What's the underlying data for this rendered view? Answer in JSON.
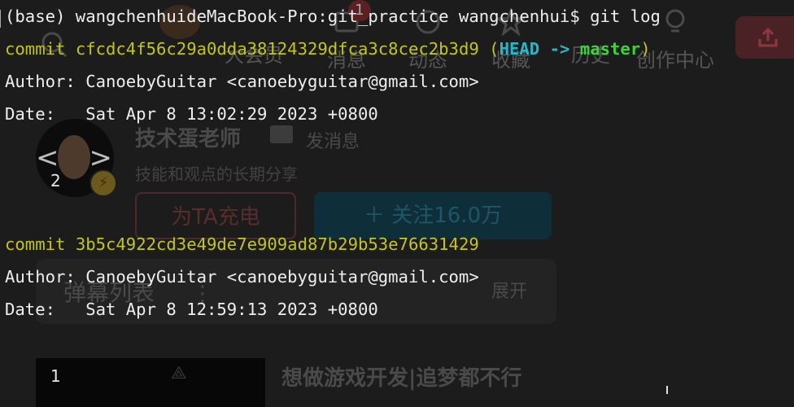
{
  "terminal": {
    "prompt_line": "(base) wangchenhuideMacBook-Pro:git_practice wangchenhui$ git log",
    "commits": [
      {
        "commit_label": "commit",
        "hash": "cfcdc4f56c29a0dda38124329dfca3c8cec2b3d9",
        "ref_open": "(",
        "ref_head": "HEAD",
        "ref_arrow": "->",
        "ref_branch": "master",
        "ref_close": ")",
        "author_line": "Author: CanoebyGuitar <canoebyguitar@gmail.com>",
        "date_line": "Date:   Sat Apr 8 13:02:29 2023 +0800"
      },
      {
        "commit_label": "commit",
        "hash": "3b5c4922cd3e49de7e909ad87b29b53e76631429",
        "author_line": "Author: CanoebyGuitar <canoebyguitar@gmail.com>",
        "date_line": "Date:   Sat Apr 8 12:59:13 2023 +0800"
      }
    ]
  },
  "background_ui": {
    "nav": [
      "大会员",
      "消息",
      "动态",
      "收藏",
      "历史",
      "创作中心"
    ],
    "notify_count": "1",
    "up_name": "技术蛋老师",
    "send_message": "发消息",
    "up_desc": "技能和观点的长期分享",
    "charge_button": "为TA充电",
    "follow_button": "关注16.0万",
    "follow_plus": "＋",
    "danmu_title": "弹幕列表",
    "danmu_dots": "⋮",
    "danmu_expand": "展开",
    "video_title": "想做游戏开发|追梦都不行",
    "overlay_numbers": [
      "2",
      "1"
    ]
  },
  "colors": {
    "terminal_bg": "#1c1c1c",
    "text": "#eeeeee",
    "commit_yellow": "#c2c51c",
    "head_cyan": "#28b6c9",
    "branch_green": "#3fd23f"
  }
}
